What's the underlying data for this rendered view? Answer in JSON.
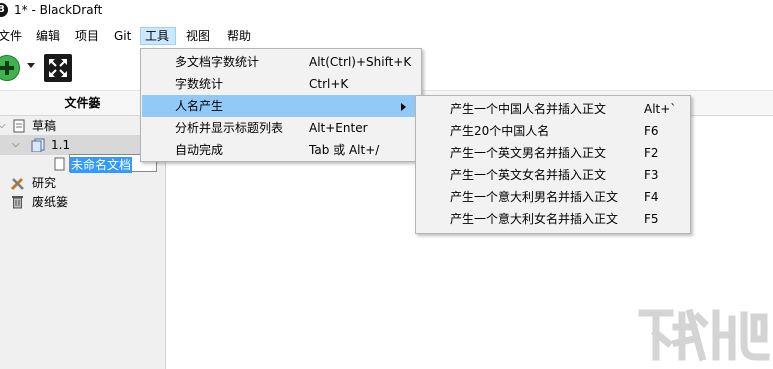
{
  "window": {
    "logo_text": "B",
    "title": "1* - BlackDraft"
  },
  "menubar": {
    "items": [
      "文件",
      "编辑",
      "项目",
      "Git",
      "工具",
      "视图",
      "帮助"
    ],
    "active": "工具"
  },
  "toolbar": {
    "add_icon": "plus-circle-icon",
    "fullscreen_icon": "fullscreen-icon"
  },
  "sidebar": {
    "header": "文件篓",
    "tree": [
      {
        "label": "草稿",
        "icon": "notebook-icon"
      },
      {
        "label": "1.1",
        "icon": "document-stack-icon"
      },
      {
        "label": "未命名文档",
        "icon": "file-icon",
        "editing": true
      },
      {
        "label": "研究",
        "icon": "tools-icon"
      },
      {
        "label": "废纸篓",
        "icon": "trash-icon"
      }
    ]
  },
  "tools_menu": {
    "items": [
      {
        "label": "多文档字数统计",
        "shortcut": "Alt(Ctrl)+Shift+K"
      },
      {
        "label": "字数统计",
        "shortcut": "Ctrl+K"
      },
      {
        "label": "人名产生",
        "shortcut": "",
        "submenu": true,
        "highlighted": true
      },
      {
        "label": "分析并显示标题列表",
        "shortcut": "Alt+Enter"
      },
      {
        "label": "自动完成",
        "shortcut": "Tab 或 Alt+/"
      }
    ]
  },
  "name_submenu": {
    "items": [
      {
        "label": "产生一个中国人名并插入正文",
        "shortcut": "Alt+`"
      },
      {
        "label": "产生20个中国人名",
        "shortcut": "F6"
      },
      {
        "label": "产生一个英文男名并插入正文",
        "shortcut": "F2"
      },
      {
        "label": "产生一个英文女名并插入正文",
        "shortcut": "F3"
      },
      {
        "label": "产生一个意大利男名并插入正文",
        "shortcut": "F4"
      },
      {
        "label": "产生一个意大利女名并插入正文",
        "shortcut": "F5"
      }
    ]
  },
  "colors": {
    "highlight": "#91c9f7",
    "menu_bg": "#f2f2f2",
    "active_menu": "#cce8ff",
    "add_green": "#3fb34f"
  }
}
